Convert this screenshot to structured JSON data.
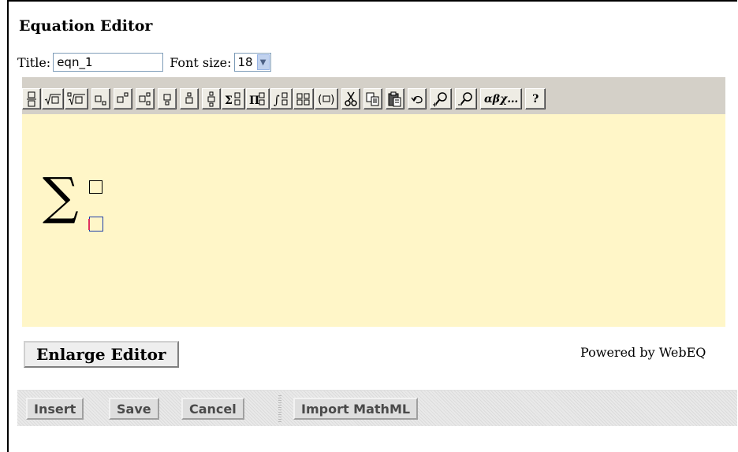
{
  "editor": {
    "heading": "Equation Editor",
    "title_label": "Title:",
    "title_value": "eqn_1",
    "font_size_label": "Font size:",
    "font_size_value": "18"
  },
  "toolbar": {
    "buttons": [
      {
        "name": "fraction-icon",
        "glyph": ""
      },
      {
        "name": "square-root-icon",
        "glyph": ""
      },
      {
        "name": "nth-root-icon",
        "glyph": ""
      },
      {
        "name": "subscript-icon",
        "glyph": ""
      },
      {
        "name": "superscript-icon",
        "glyph": ""
      },
      {
        "name": "sub-superscript-icon",
        "glyph": ""
      },
      {
        "name": "underscript-icon",
        "glyph": ""
      },
      {
        "name": "overscript-icon",
        "glyph": ""
      },
      {
        "name": "under-overscript-icon",
        "glyph": ""
      },
      {
        "name": "summation-icon",
        "glyph": ""
      },
      {
        "name": "product-icon",
        "glyph": ""
      },
      {
        "name": "integral-icon",
        "glyph": ""
      },
      {
        "name": "matrix-icon",
        "glyph": ""
      },
      {
        "name": "parentheses-icon",
        "glyph": ""
      },
      {
        "name": "cut-icon",
        "glyph": ""
      },
      {
        "name": "copy-icon",
        "glyph": ""
      },
      {
        "name": "paste-icon",
        "glyph": ""
      },
      {
        "name": "undo-icon",
        "glyph": ""
      },
      {
        "name": "zoom-in-icon",
        "glyph": ""
      },
      {
        "name": "zoom-out-icon",
        "glyph": ""
      },
      {
        "name": "greek-letters-button",
        "glyph": "αβχ…"
      },
      {
        "name": "help-button",
        "glyph": "?"
      }
    ]
  },
  "equation": {
    "operator": "∑"
  },
  "enlarge_label": "Enlarge Editor",
  "powered_by": "Powered by WebEQ",
  "actions": {
    "insert": "Insert",
    "save": "Save",
    "cancel": "Cancel",
    "import": "Import MathML"
  },
  "colors": {
    "canvas_bg": "#fff6c8",
    "toolbar_bg": "#d4d0c8"
  }
}
